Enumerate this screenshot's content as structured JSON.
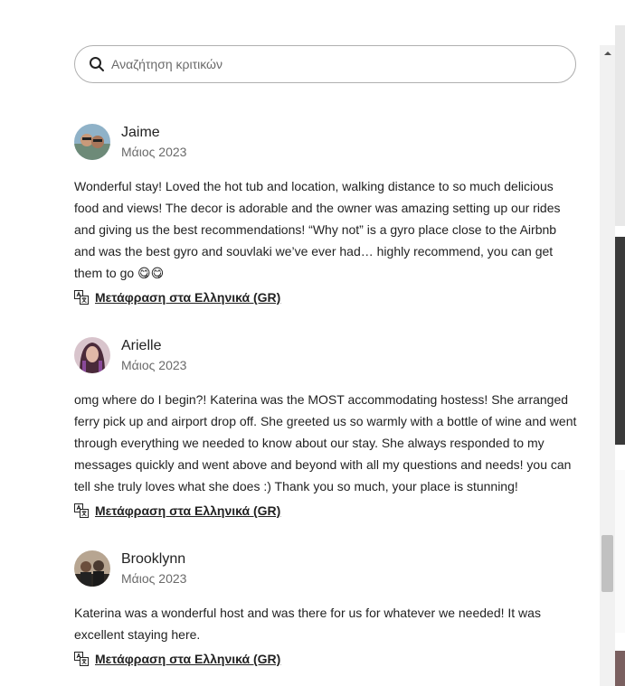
{
  "search": {
    "placeholder": "Αναζήτηση κριτικών",
    "value": ""
  },
  "reviews": [
    {
      "name": "Jaime",
      "date": "Μάιος 2023",
      "text": "Wonderful stay! Loved the hot tub and location, walking distance to so much delicious food and views! The decor is adorable and the owner was amazing setting up our rides and giving us the best recommendations! “Why not” is a gyro place close to the Airbnb and was the best gyro and souvlaki we’ve ever had… highly recommend, you can get them to go 😋😋",
      "translate_label": "Μετάφραση στα Ελληνικά (GR)"
    },
    {
      "name": "Arielle",
      "date": "Μάιος 2023",
      "text": "omg where do I begin?! Katerina was the MOST accommodating hostess! She arranged ferry pick up and airport drop off. She greeted us so warmly with a bottle of wine and went through everything we needed to know about our stay. She always responded to my messages quickly and went above and beyond with all my questions and needs! you can tell she truly loves what she does :) Thank you so much, your place is stunning!",
      "translate_label": "Μετάφραση στα Ελληνικά (GR)"
    },
    {
      "name": "Brooklynn",
      "date": "Μάιος 2023",
      "text": "Katerina was a wonderful host and was there for us for whatever we needed! It was excellent staying here.",
      "translate_label": "Μετάφραση στα Ελληνικά (GR)"
    }
  ],
  "icons": {
    "search": "search-icon",
    "translate": "translate-icon",
    "scroll_up": "scroll-up-arrow-icon"
  },
  "colors": {
    "text": "#222222",
    "muted": "#6a6a6a",
    "border": "#b0b0b0"
  }
}
